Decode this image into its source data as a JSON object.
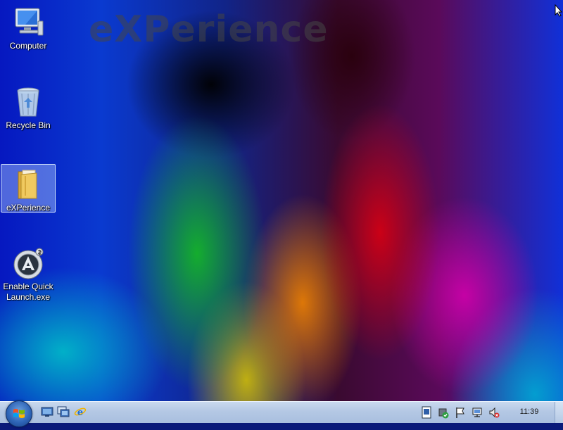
{
  "wallpaper": {
    "brand_text": "eXPerience"
  },
  "desktop": {
    "icons": [
      {
        "label": "Computer",
        "icon": "computer-icon",
        "selected": false
      },
      {
        "label": "Recycle Bin",
        "icon": "recycle-bin-icon",
        "selected": false
      },
      {
        "label": "eXPerience",
        "icon": "folder-icon",
        "selected": true
      },
      {
        "label": "Enable Quick Launch.exe",
        "icon": "app-icon",
        "selected": false
      }
    ]
  },
  "taskbar": {
    "start_icon": "windows-logo-icon",
    "quick_launch": [
      "show-desktop-icon",
      "switch-windows-icon",
      "internet-explorer-icon"
    ],
    "tray": [
      "document-icon",
      "security-shield-icon",
      "action-center-flag-icon",
      "network-icon",
      "volume-muted-icon"
    ],
    "clock": "11:39"
  },
  "colors": {
    "taskbar": "#b4c8e4",
    "selection": "#aac8ff"
  }
}
